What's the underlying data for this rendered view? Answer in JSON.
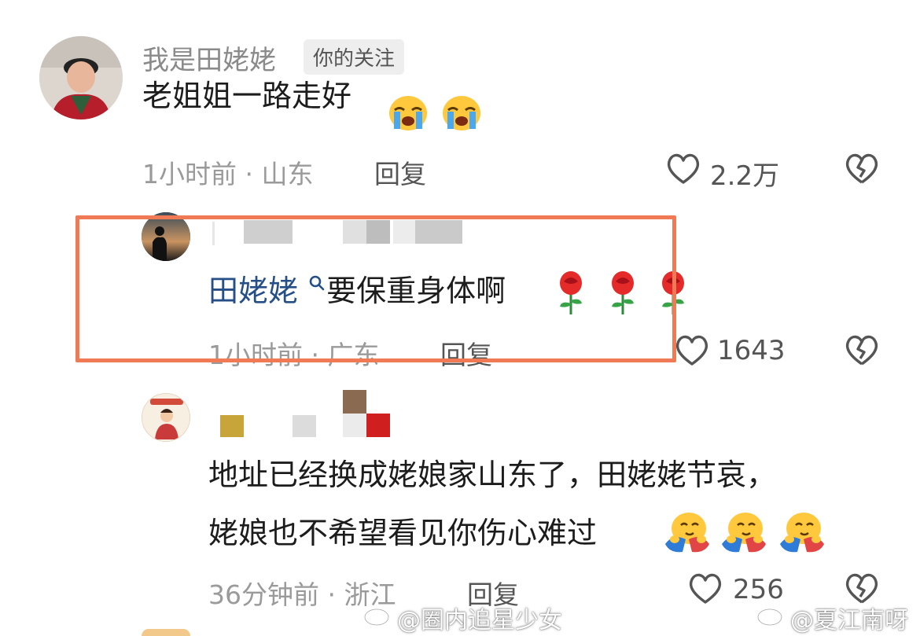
{
  "comments": [
    {
      "username": "我是田姥姥",
      "badge": "你的关注",
      "text": "老姐姐一路走好",
      "emoji_name": "crying-face-icon",
      "time_location": "1小时前 · 山东",
      "reply_label": "回复",
      "likes": "2.2万"
    },
    {
      "mention": "田姥姥",
      "text": "要保重身体啊",
      "emoji_name": "rose-icon",
      "time_location": "1小时前 · 广东",
      "reply_label": "回复",
      "likes": "1643"
    },
    {
      "text_line1": "地址已经换成姥娘家山东了，田姥姥节哀，",
      "text_line2": "姥娘也不希望看见你伤心难过",
      "emoji_name": "hugging-face-icon",
      "time_location": "36分钟前 · 浙江",
      "reply_label": "回复",
      "likes": "256"
    }
  ],
  "watermarks": {
    "left": "@圈内追星少女",
    "right": "@夏江南呀"
  },
  "colors": {
    "highlight_border": "#ef7a55",
    "mention": "#254f86",
    "meta_text": "#9a9a9a"
  }
}
